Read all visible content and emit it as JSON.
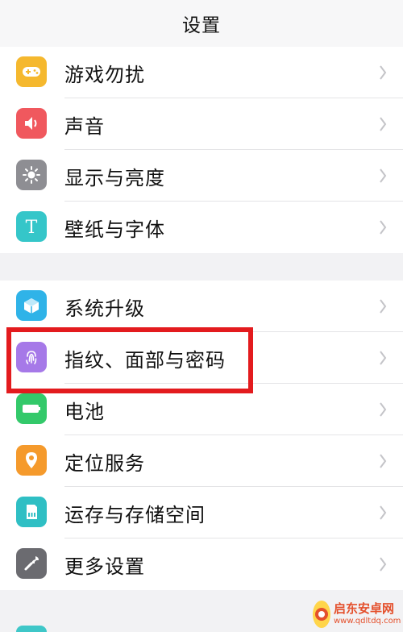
{
  "nav": {
    "title": "设置"
  },
  "group1": [
    {
      "label": "游戏勿扰",
      "icon": "gamepad-icon",
      "color": "#f5b82e"
    },
    {
      "label": "声音",
      "icon": "speaker-icon",
      "color": "#f0585e"
    },
    {
      "label": "显示与亮度",
      "icon": "brightness-icon",
      "color": "#8e8e93"
    },
    {
      "label": "壁纸与字体",
      "icon": "font-t-icon",
      "color": "#35c6c9"
    }
  ],
  "group2": [
    {
      "label": "系统升级",
      "icon": "upgrade-box-icon",
      "color": "#2fb3e8"
    },
    {
      "label": "指纹、面部与密码",
      "icon": "fingerprint-icon",
      "color": "#a679e8"
    },
    {
      "label": "电池",
      "icon": "battery-icon",
      "color": "#33c96a"
    },
    {
      "label": "定位服务",
      "icon": "location-pin-icon",
      "color": "#f59a2c"
    },
    {
      "label": "运存与存储空间",
      "icon": "storage-chip-icon",
      "color": "#2fbfc4"
    },
    {
      "label": "更多设置",
      "icon": "wrench-icon",
      "color": "#6b6b70"
    }
  ],
  "highlight_color": "#e31b1e",
  "watermark": {
    "name": "启东安卓网",
    "url": "www.qdltdq.com"
  }
}
